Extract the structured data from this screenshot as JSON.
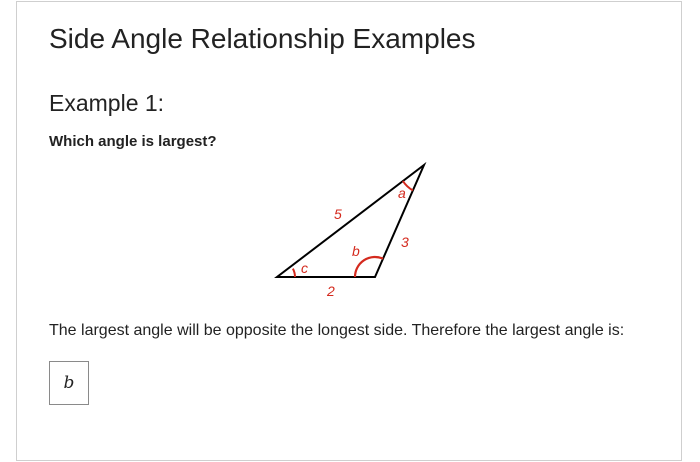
{
  "page": {
    "title": "Side Angle Relationship Examples"
  },
  "example": {
    "heading": "Example 1:",
    "question": "Which angle is largest?",
    "explanation": "The largest angle will be opposite the longest side. Therefore the largest angle is:",
    "answer": "b"
  },
  "triangle": {
    "side_labels": {
      "long": "5",
      "right": "3",
      "bottom": "2"
    },
    "angle_labels": {
      "top": "a",
      "bottom_right": "b",
      "left": "c"
    },
    "colors": {
      "outline": "#000000",
      "labels": "#d42a1e",
      "arcs": "#d42a1e"
    }
  }
}
